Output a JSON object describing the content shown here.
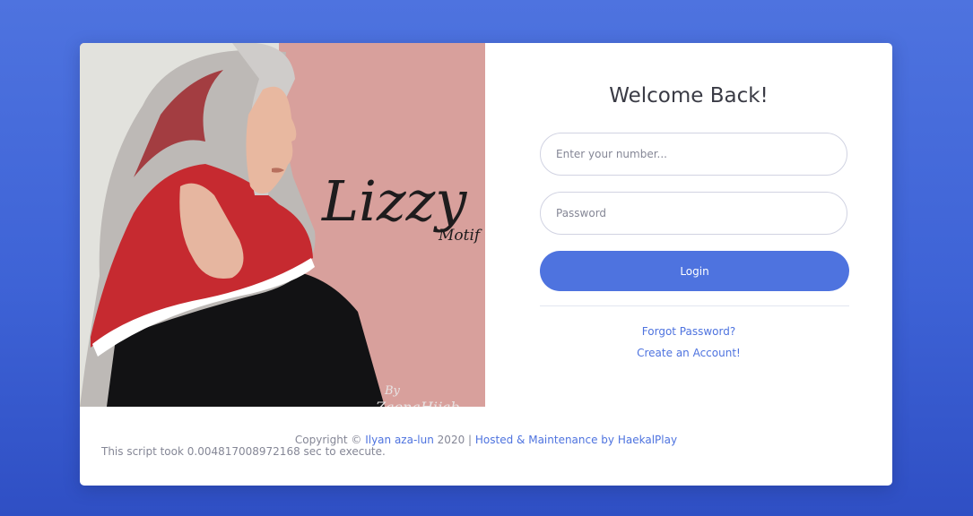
{
  "hero": {
    "script_text": "Lizzy",
    "motif_text": "Motif",
    "by_text": "By",
    "brand_text": "ZaenaHijab"
  },
  "form": {
    "title": "Welcome Back!",
    "number_placeholder": "Enter your number...",
    "password_placeholder": "Password",
    "login_label": "Login",
    "forgot_label": "Forgot Password?",
    "create_label": "Create an Account!"
  },
  "footer": {
    "copyright_prefix": "Copyright ©",
    "author": "Ilyan aza-lun",
    "year_sep": "2020 |",
    "hosted": "Hosted & Maintenance by HaekalPlay",
    "exec_time": "This script took 0.004817008972168 sec to execute."
  },
  "colors": {
    "background": "#4e73df",
    "accent": "#4e73df",
    "hero_pink": "#d8a09c"
  }
}
